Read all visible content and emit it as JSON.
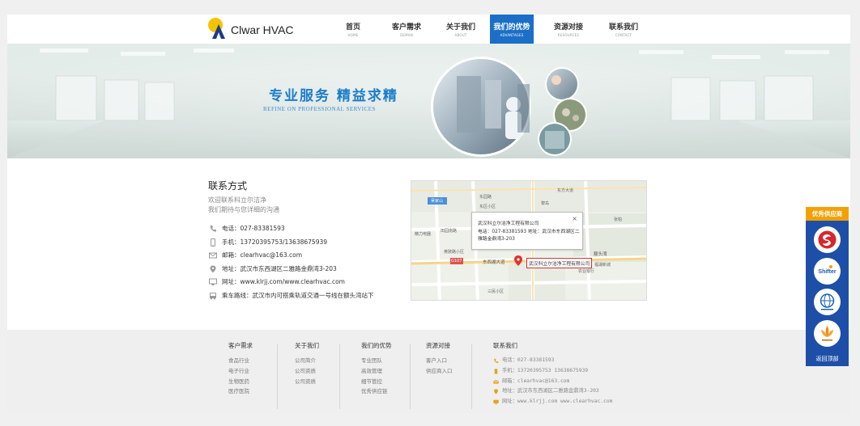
{
  "header": {
    "brand": "Clwar HVAC",
    "nav": [
      {
        "cn": "首页",
        "en": "HOME"
      },
      {
        "cn": "客户需求",
        "en": "DEMAN"
      },
      {
        "cn": "关于我们",
        "en": "ABOUT"
      },
      {
        "cn": "我们的优势",
        "en": "ADVANTAGES"
      },
      {
        "cn": "资源对接",
        "en": "RESOURCES"
      },
      {
        "cn": "联系我们",
        "en": "CONTACT"
      }
    ],
    "active_index": 3
  },
  "banner": {
    "slogan_cn": "专业服务  精益求精",
    "slogan_en": "REFINE ON PROFESSIONAL SERVICES"
  },
  "contact": {
    "title": "联系方式",
    "subtitle_1": "欢迎联系科立尔洁净",
    "subtitle_2": "我们期待与您详细的沟通",
    "items": [
      {
        "icon": "phone-icon",
        "text": "电话：027-83381593"
      },
      {
        "icon": "mobile-icon",
        "text": "手机：13720395753/13638675939"
      },
      {
        "icon": "mail-icon",
        "text": "邮箱：clearhvac@163.com"
      },
      {
        "icon": "location-icon",
        "text": "地址：武汉市东西湖区二雅路金鼎湾3-203"
      },
      {
        "icon": "website-icon",
        "text": "网址：www.klrjj.com/www.clearhvac.com"
      },
      {
        "icon": "bus-icon",
        "text": "乘车路线：武汉市内可搭乘轨道交通一号线在额头湾站下"
      }
    ]
  },
  "map": {
    "popup_title": "武汉科立尔洁净工程有限公司",
    "popup_detail": "电话：027-83381593 地址：武汉市东西湖区二雅路金鼎湾3-203",
    "popup_close": "×",
    "pin_label": "武汉科立尔洁净工程有限公司",
    "labels": {
      "wujiashan": "吴家山",
      "dongfang": "东方大道",
      "dongxihu_avenue": "东西湖大道",
      "etouwan": "额头湾",
      "sanmin": "三民小区",
      "huangpo": "黄陂路小区",
      "tianyuan": "田园南路",
      "jingli": "精力电器",
      "zhangbai": "张柏",
      "nongye": "农业银行",
      "road_0107": "G107",
      "dongyuan": "东园路",
      "dongqu": "东区小区",
      "lidao": "黎岛",
      "fuhu": "福湖新城"
    }
  },
  "footer": {
    "columns": [
      {
        "title": "客户需求",
        "links": [
          "食品行业",
          "电子行业",
          "生物医药",
          "医疗医院"
        ]
      },
      {
        "title": "关于我们",
        "links": [
          "公司简介",
          "公司资质",
          "公司资质"
        ]
      },
      {
        "title": "我们的优势",
        "links": [
          "专业团队",
          "高效管理",
          "细节管控",
          "优秀供应链"
        ]
      },
      {
        "title": "资源对接",
        "links": [
          "客户入口",
          "供应商入口"
        ]
      }
    ],
    "contact_title": "联系我们",
    "contact_items": [
      {
        "icon": "phone-icon",
        "text": "电话：027-83381593"
      },
      {
        "icon": "mobile-icon",
        "text": "手机：13720395753  13638675939"
      },
      {
        "icon": "mail-icon",
        "text": "邮箱：clearhvac@163.com"
      },
      {
        "icon": "location-icon",
        "text": "地址：武汉市东西湖区二雅路金鼎湾3-203"
      },
      {
        "icon": "website-icon",
        "text": "网址：www.klrjj.com  www.clearhvac.com"
      }
    ]
  },
  "side": {
    "title": "优秀供应商",
    "back_top": "返回顶部",
    "suppliers": [
      "supplier-logo-red",
      "supplier-logo-shifter",
      "supplier-logo-globe",
      "supplier-logo-lotus"
    ]
  },
  "colors": {
    "accent": "#1b6fc7",
    "side_blue": "#1e4fa8",
    "side_orange": "#f2a100",
    "slogan": "#1d7ec9"
  }
}
